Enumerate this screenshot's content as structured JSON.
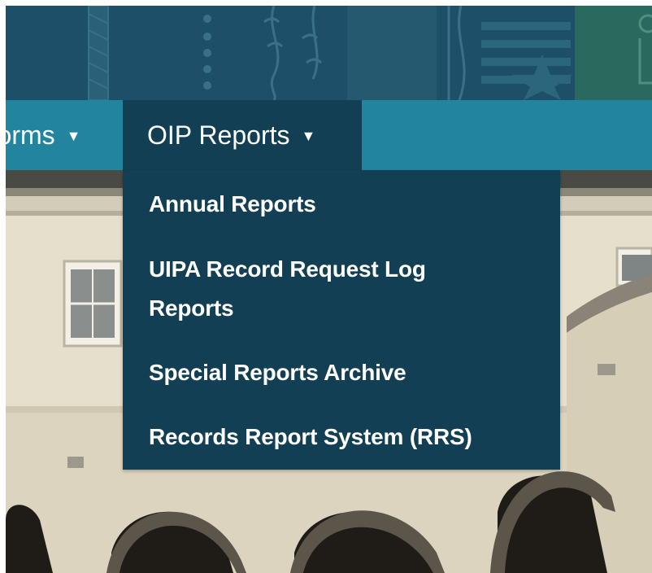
{
  "nav": {
    "forms_label": "Forms",
    "reports_label": "OIP Reports",
    "caret_icon": "caret-down-icon"
  },
  "dropdown": {
    "items": [
      {
        "label": "Annual Reports"
      },
      {
        "label_line1": "UIPA Record Request Log",
        "label_line2": "Reports"
      },
      {
        "label": "Special Reports Archive"
      },
      {
        "label": "Records Report System (RRS)"
      }
    ]
  },
  "colors": {
    "banner": "#1d5068",
    "navbar": "#22849e",
    "dropdown": "#123f53",
    "text": "#ffffff"
  }
}
